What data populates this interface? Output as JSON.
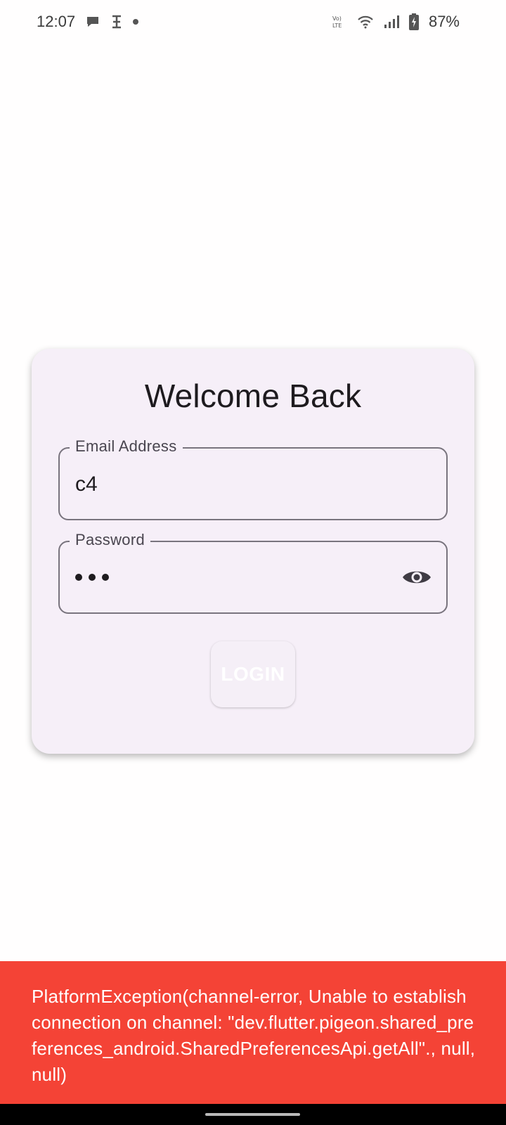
{
  "status_bar": {
    "time": "12:07",
    "battery": "87%",
    "icons": [
      "chat-bubble-icon",
      "app-notification-icon",
      "dot-icon",
      "volte-icon",
      "wifi-icon",
      "signal-icon",
      "battery-charging-icon"
    ]
  },
  "card": {
    "title": "Welcome Back",
    "email": {
      "label": "Email Address",
      "value": "c4"
    },
    "password": {
      "label": "Password",
      "dot_count": 3
    },
    "login_label": "LOGIN"
  },
  "snackbar": {
    "message": "PlatformException(channel-error, Unable to establish connection on channel: \"dev.flutter.pigeon.shared_preferences_android.SharedPreferencesApi.getAll\"., null, null)",
    "color": "#f44336"
  }
}
